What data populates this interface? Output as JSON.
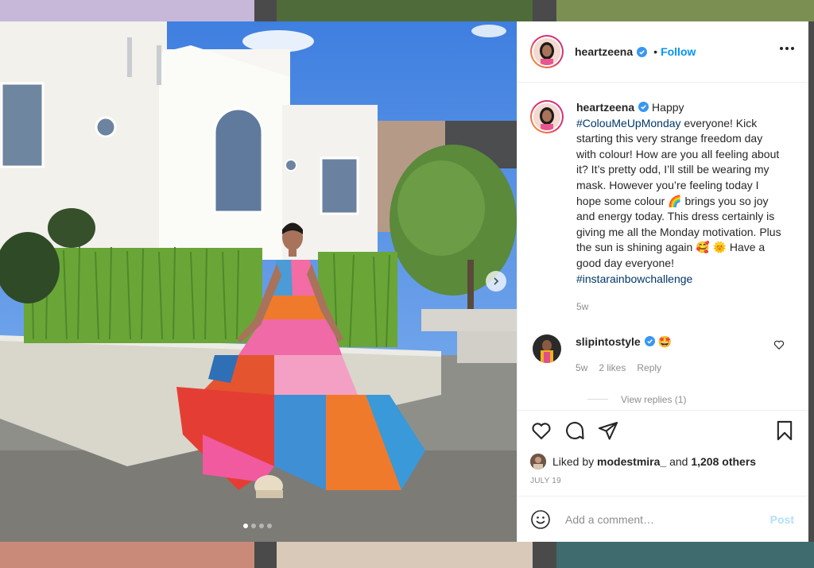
{
  "post": {
    "author": "heartzeena",
    "follow_label": "Follow",
    "follow_sep": "•",
    "caption_intro": "Happy ",
    "caption_tag1": "#ColouMeUpMonday",
    "caption_body": " everyone! Kick starting this very strange freedom day with colour! How are you all feeling about it? It’s pretty odd, I’ll still be wearing my mask. However you’re feeling today I hope some colour 🌈 brings you so joy and energy today. This dress certainly is giving me all the Monday motivation. Plus the sun is shining again 🥰 🌞 Have a good day everyone! ",
    "caption_tag2": "#instarainbowchallenge",
    "caption_age": "5w",
    "date": "JULY 19",
    "media_dots": 4,
    "media_active_dot": 0
  },
  "comment": {
    "author": "slipintostyle",
    "text": "🤩",
    "age": "5w",
    "likes": "2 likes",
    "reply": "Reply",
    "view_replies": "View replies (1)"
  },
  "likes": {
    "prefix": "Liked by ",
    "user": "modestmira_",
    "mid": " and ",
    "others": "1,208 others"
  },
  "composer": {
    "placeholder": "Add a comment…",
    "post_label": "Post"
  },
  "colors": {
    "accent": "#0095f6",
    "post_disabled": "#b2dffc",
    "verified": "#3897f0"
  },
  "icons": [
    "heart-icon",
    "comment-icon",
    "share-icon",
    "bookmark-icon",
    "emoji-icon",
    "more-icon",
    "verified-icon",
    "chevron-right-icon"
  ]
}
